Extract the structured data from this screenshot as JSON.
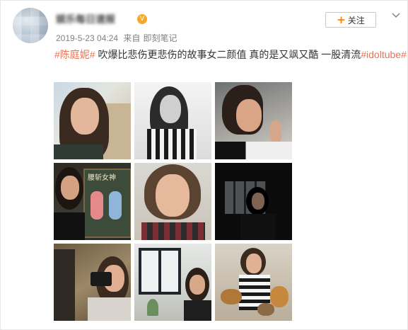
{
  "post": {
    "username": "娱乐每日速报",
    "vip_badge": "V",
    "timestamp": "2019-5-23 04:24",
    "source_prefix": "来自",
    "source": "即刻笔记",
    "follow_label": "关注",
    "follow_plus": "+",
    "tag1": "#陈庭妮#",
    "body": " 吹爆比悲伤更悲伤的故事女二颜值 真的是又飒又酷 一股清流",
    "tag2": "#idoltube#"
  },
  "colors": {
    "accent_orange": "#ff8200",
    "tag_color": "#eb7350",
    "meta_gray": "#808080"
  },
  "icons": {
    "follow": "plus-icon",
    "menu": "chevron-down-icon",
    "vip": "vip-badge-icon"
  },
  "photos": [
    {
      "id": "photo-1"
    },
    {
      "id": "photo-2"
    },
    {
      "id": "photo-3"
    },
    {
      "id": "photo-4"
    },
    {
      "id": "photo-5"
    },
    {
      "id": "photo-6"
    },
    {
      "id": "photo-7"
    },
    {
      "id": "photo-8"
    },
    {
      "id": "photo-9"
    }
  ],
  "photo_text": {
    "chalkboard": "腰斩女神"
  }
}
